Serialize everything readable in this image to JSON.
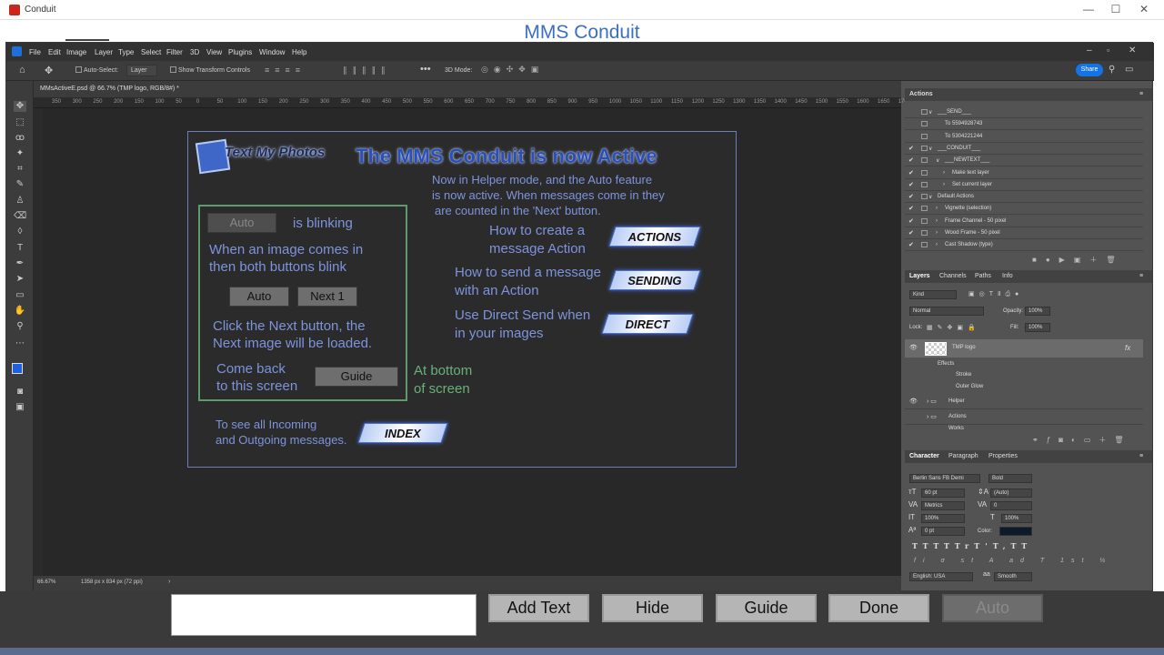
{
  "window": {
    "title": "Conduit",
    "controls": [
      "—",
      "☐",
      "✕"
    ]
  },
  "app_header": {
    "title": "MMS Conduit"
  },
  "ps": {
    "menu": [
      "File",
      "Edit",
      "Image",
      "Layer",
      "Type",
      "Select",
      "Filter",
      "3D",
      "View",
      "Plugins",
      "Window",
      "Help"
    ],
    "options": {
      "auto_select": "Auto-Select:",
      "layer": "Layer",
      "transform": "Show Transform Controls",
      "mode3d": "3D Mode:",
      "share": "Share"
    },
    "doc_tab": "MMsActiveE.psd @ 66.7% (TMP logo, RGB/8#) *",
    "ruler": [
      "350",
      "300",
      "250",
      "200",
      "150",
      "100",
      "50",
      "0",
      "50",
      "100",
      "150",
      "200",
      "250",
      "300",
      "350",
      "400",
      "450",
      "500",
      "550",
      "600",
      "650",
      "700",
      "750",
      "800",
      "850",
      "900",
      "950",
      "1000",
      "1050",
      "1100",
      "1150",
      "1200",
      "1250",
      "1300",
      "1350",
      "1400",
      "1450",
      "1500",
      "1550",
      "1600",
      "1650",
      "1700",
      "175"
    ],
    "status": {
      "zoom": "66.67%",
      "size": "1358 px x 834 px (72 ppi)"
    }
  },
  "doc": {
    "logo_text": "Text My Photos",
    "headline": "The MMS Conduit is now Active",
    "intro": [
      "Now in Helper mode, and the Auto feature",
      "is now active. When messages come in they",
      "are counted in the 'Next' button."
    ],
    "auto_btn": "Auto",
    "is_blinking": "is blinking",
    "when_image": [
      "When an image comes in",
      "then both buttons blink"
    ],
    "auto_btn2": "Auto",
    "next_btn": "Next 1",
    "click_next": [
      "Click the Next button, the",
      "Next image will be loaded."
    ],
    "come_back": [
      "Come back",
      "to this screen"
    ],
    "guide_btn": "Guide",
    "at_bottom": [
      "At bottom",
      "of screen"
    ],
    "how_create": [
      "How to create a",
      "message Action"
    ],
    "how_send": [
      "How to send a message",
      "with an Action"
    ],
    "direct_send": [
      "Use Direct Send when",
      "in your images"
    ],
    "see_all": [
      "To see all Incoming",
      "and Outgoing messages."
    ],
    "tags": {
      "actions": "ACTIONS",
      "sending": "SENDING",
      "direct": "DIRECT",
      "index": "INDEX"
    }
  },
  "actions_panel": {
    "title": "Actions",
    "rows": [
      "___SEND___",
      "To 5594928743",
      "To 5304221244",
      "___CONDUIT___",
      "___NEWTEXT___",
      "Make text layer",
      "Set current layer",
      "Default Actions",
      "Vignette (selection)",
      "Frame Channel - 50 pixel",
      "Wood Frame - 50 pixel",
      "Cast Shadow (type)"
    ]
  },
  "layers_panel": {
    "tabs": [
      "Layers",
      "Channels",
      "Paths",
      "Info"
    ],
    "kind": "Kind",
    "blend": "Normal",
    "opacity_label": "Opacity:",
    "opacity": "100%",
    "lock_label": "Lock:",
    "fill_label": "Fill:",
    "fill": "100%",
    "layers": [
      "TMP logo",
      "Effects",
      "Stroke",
      "Outer Glow",
      "Helper",
      "Actions",
      "Works"
    ],
    "fx": "fx"
  },
  "char_panel": {
    "tabs": [
      "Character",
      "Paragraph",
      "Properties"
    ],
    "font": "Berlin Sans FB Demi",
    "style": "Bold",
    "size": "60 pt",
    "leading": "(Auto)",
    "kerning": "Metrics",
    "tracking": "0",
    "vscale": "100%",
    "hscale": "100%",
    "baseline": "0 pt",
    "color_label": "Color:",
    "type_buttons": [
      "T",
      "T",
      "TT",
      "Tr",
      "T'",
      "T,",
      "T",
      "T"
    ],
    "language": "English: USA",
    "aa": "Smooth"
  },
  "bottom": {
    "add_text": "Add Text",
    "hide": "Hide",
    "guide": "Guide",
    "done": "Done",
    "auto": "Auto"
  }
}
